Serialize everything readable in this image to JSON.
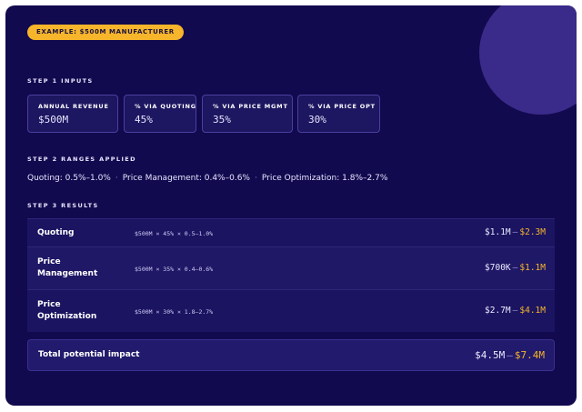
{
  "badge": "EXAMPLE: $500M MANUFACTURER",
  "step1": {
    "title": "STEP 1 INPUTS",
    "inputs": [
      {
        "label": "ANNUAL REVENUE",
        "value": "$500M"
      },
      {
        "label": "% VIA QUOTING",
        "value": "45%"
      },
      {
        "label": "% VIA PRICE MGMT",
        "value": "35%"
      },
      {
        "label": "% VIA PRICE OPT",
        "value": "30%"
      }
    ]
  },
  "step2": {
    "title": "STEP 2 RANGES APPLIED",
    "ranges": [
      "Quoting: 0.5%–1.0%",
      "Price Management: 0.4%–0.6%",
      "Price Optimization: 1.8%–2.7%"
    ],
    "separator": "·"
  },
  "step3": {
    "title": "STEP 3 RESULTS",
    "rows": [
      {
        "name": "Quoting",
        "formula": "$500M × 45% × 0.5–1.0%",
        "low": "$1.1M",
        "high": "$2.3M"
      },
      {
        "name": "Price Management",
        "formula": "$500M × 35% × 0.4–0.6%",
        "low": "$700K",
        "high": "$1.1M"
      },
      {
        "name": "Price Optimization",
        "formula": "$500M × 30% × 1.8–2.7%",
        "low": "$2.7M",
        "high": "$4.1M"
      }
    ],
    "dash": "–"
  },
  "total": {
    "label": "Total potential impact",
    "low": "$4.5M",
    "high": "$7.4M"
  },
  "colors": {
    "background": "#120a4e",
    "accent": "#f6b52b",
    "panel": "#1d1660"
  }
}
